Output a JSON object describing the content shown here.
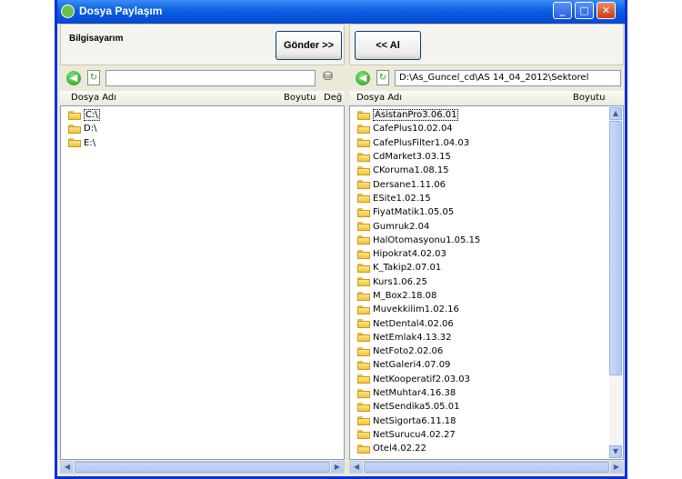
{
  "window": {
    "title": "Dosya Paylaşım",
    "controls": {
      "minimize": "_",
      "maximize": "□",
      "close": "✕"
    }
  },
  "left_panel": {
    "label": "Bilgisayarım",
    "send_button": "Gönder >>",
    "path": "",
    "columns": {
      "name": "Dosya Adı",
      "size": "Boyutu",
      "modified": "Değ"
    },
    "items": [
      "C:\\",
      "D:\\",
      "E:\\"
    ]
  },
  "right_panel": {
    "receive_button": "<< Al",
    "path": "D:\\As_Guncel_cd\\AS 14_04_2012\\Sektorel",
    "columns": {
      "name": "Dosya Adı",
      "size": "Boyutu"
    },
    "items": [
      "AsistanPro3.06.01",
      "CafePlus10.02.04",
      "CafePlusFilter1.04.03",
      "CdMarket3.03.15",
      "CKoruma1.08.15",
      "Dersane1.11.06",
      "ESite1.02.15",
      "FiyatMatik1.05.05",
      "Gumruk2.04",
      "HalOtomasyonu1.05.15",
      "Hipokrat4.02.03",
      "K_Takip2.07.01",
      "Kurs1.06.25",
      "M_Box2.18.08",
      "Muvekkilim1.02.16",
      "NetDental4.02.06",
      "NetEmlak4.13.32",
      "NetFoto2.02.06",
      "NetGaleri4.07.09",
      "NetKooperatif2.03.03",
      "NetMuhtar4.16.38",
      "NetSendika5.05.01",
      "NetSigorta6.11.18",
      "NetSurucu4.02.27",
      "Otel4.02.22"
    ]
  }
}
